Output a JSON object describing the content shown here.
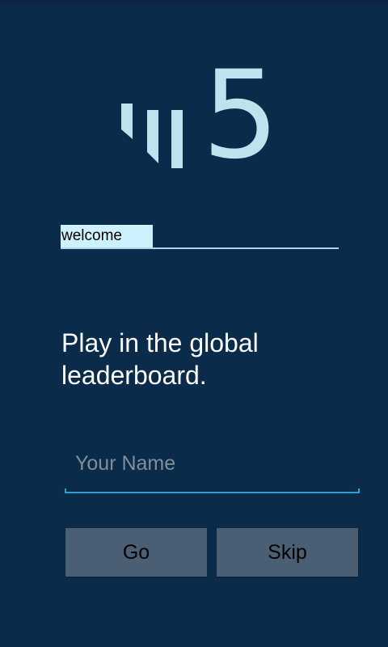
{
  "logo": {
    "digit": "5",
    "icon": "signal-bars-icon",
    "color": "#bfe2ef"
  },
  "section": {
    "label": "welcome"
  },
  "headline": "Play in the global leaderboard.",
  "name_field": {
    "placeholder": "Your Name",
    "value": ""
  },
  "buttons": {
    "go": "Go",
    "skip": "Skip"
  },
  "colors": {
    "background": "#0a2b4a",
    "accent": "#2a9fd6",
    "button": "#4a5f73",
    "tab_highlight": "#cdf2fd"
  }
}
